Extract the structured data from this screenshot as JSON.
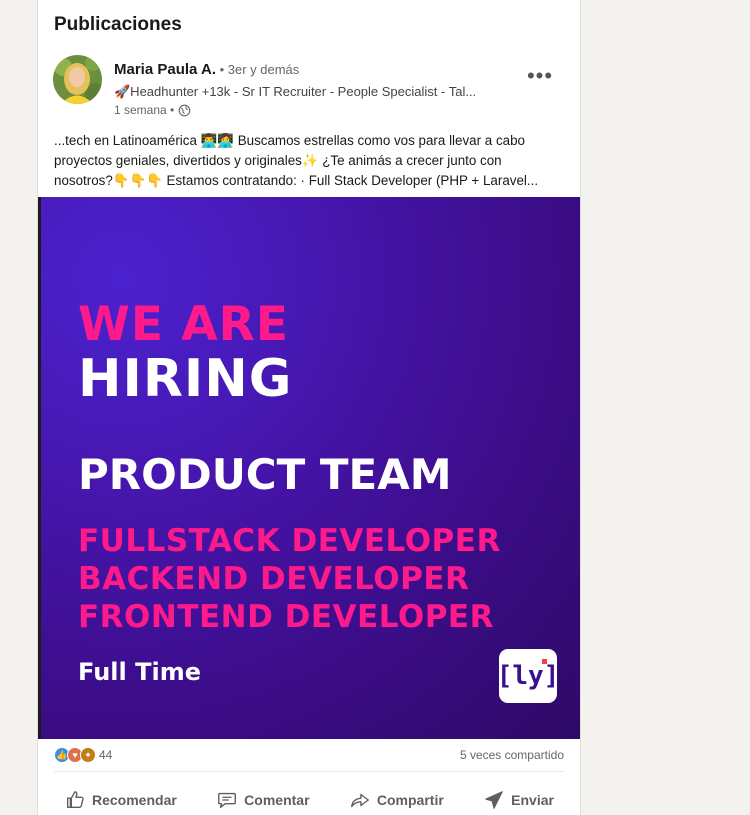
{
  "section_title": "Publicaciones",
  "post": {
    "author_name": "Maria Paula A.",
    "author_degree": " • 3er y demás",
    "headline": "🚀Headhunter +13k - Sr IT Recruiter - People Specialist - Tal...",
    "time": "1 semana •",
    "more_label": "•••",
    "text": "...tech en Latinoamérica 👨‍💻👩‍💻 Buscamos estrellas como vos para llevar a cabo proyectos geniales, divertidos y originales✨ ¿Te animás a crecer junto con nosotros?👇👇👇 Estamos contratando: · Full Stack Developer (PHP + Laravel...",
    "image": {
      "line1": "WE ARE",
      "line2": "HIRING",
      "team": "PRODUCT TEAM",
      "roles": [
        "FULLSTACK DEVELOPER",
        "BACKEND DEVELOPER",
        "FRONTEND DEVELOPER"
      ],
      "full_time": "Full Time",
      "logo_text": "[ly]",
      "colors": {
        "accent": "#ff1a8c",
        "background": "#4514a8"
      }
    },
    "reaction_count": "44",
    "shares": "5 veces compartido",
    "actions": [
      {
        "label": "Recomendar",
        "icon": "thumbs-up-icon"
      },
      {
        "label": "Comentar",
        "icon": "comment-icon"
      },
      {
        "label": "Compartir",
        "icon": "share-arrow-icon"
      },
      {
        "label": "Enviar",
        "icon": "send-icon"
      }
    ]
  }
}
